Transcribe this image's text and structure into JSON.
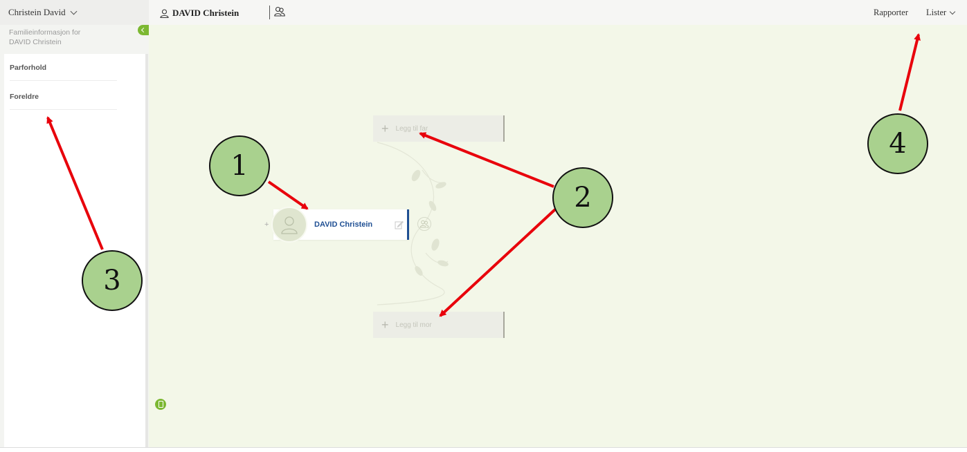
{
  "topbar": {
    "tree_selector": "Christein David",
    "active_person": "DAVID Christein",
    "menu_reports": "Rapporter",
    "menu_lists": "Lister"
  },
  "sidebar": {
    "header_line1": "Familieinformasjon for",
    "header_line2": "DAVID Christein",
    "sections": [
      {
        "label": "Parforhold"
      },
      {
        "label": "Foreldre"
      }
    ]
  },
  "canvas": {
    "person_name": "DAVID Christein",
    "add_father_label": "Legg til far",
    "add_mother_label": "Legg til mor",
    "expand_symbol": "+",
    "add_symbol": "+"
  },
  "annotations": {
    "callout_1": "1",
    "callout_2": "2",
    "callout_3": "3",
    "callout_4": "4",
    "arrow_color": "#e8000b",
    "callout_color": "#a9d18e"
  },
  "colors": {
    "canvas_bg": "#f3f7e8",
    "accent_green": "#7cb832",
    "person_blue": "#1f4f93"
  },
  "icons": [
    "person-icon",
    "persons-icon",
    "chevron-down-icon",
    "collapse-chevron-icon",
    "avatar-icon",
    "edit-icon",
    "family-icon",
    "phone-icon"
  ]
}
